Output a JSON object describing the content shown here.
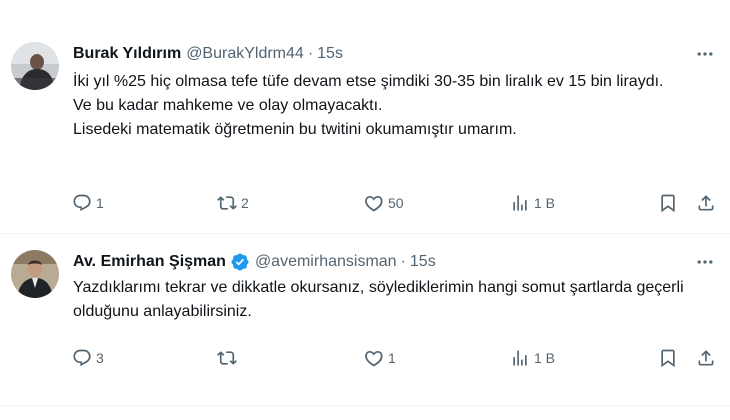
{
  "tweets": [
    {
      "author_name": "Burak Yıldırım",
      "handle": "@BurakYldrm44",
      "separator": "·",
      "time": "15s",
      "verified": false,
      "lines": [
        "İki yıl %25 hiç olmasa tefe tüfe devam etse şimdiki 30-35 bin liralık ev 15 bin liraydı.",
        "Ve bu kadar mahkeme ve olay olmayacaktı.",
        "Lisedeki matematik öğretmenin bu twitini okumamıştır umarım."
      ],
      "replies": "1",
      "retweets": "2",
      "likes": "50",
      "views": "1 B"
    },
    {
      "author_name": "Av. Emirhan Şişman",
      "handle": "@avemirhansisman",
      "separator": "·",
      "time": "15s",
      "verified": true,
      "lines": [
        "Yazdıklarımı tekrar ve dikkatle okursanız, söylediklerimin hangi somut şartlarda geçerli olduğunu anlayabilirsiniz."
      ],
      "replies": "3",
      "retweets": "",
      "likes": "1",
      "views": "1 B"
    }
  ],
  "colors": {
    "text": "#0f1419",
    "secondary": "#536471",
    "verified": "#1d9bf0",
    "divider": "#eff3f4"
  },
  "icons": [
    "more-icon",
    "reply-icon",
    "retweet-icon",
    "like-icon",
    "views-icon",
    "bookmark-icon",
    "share-icon",
    "verified-badge-icon"
  ]
}
